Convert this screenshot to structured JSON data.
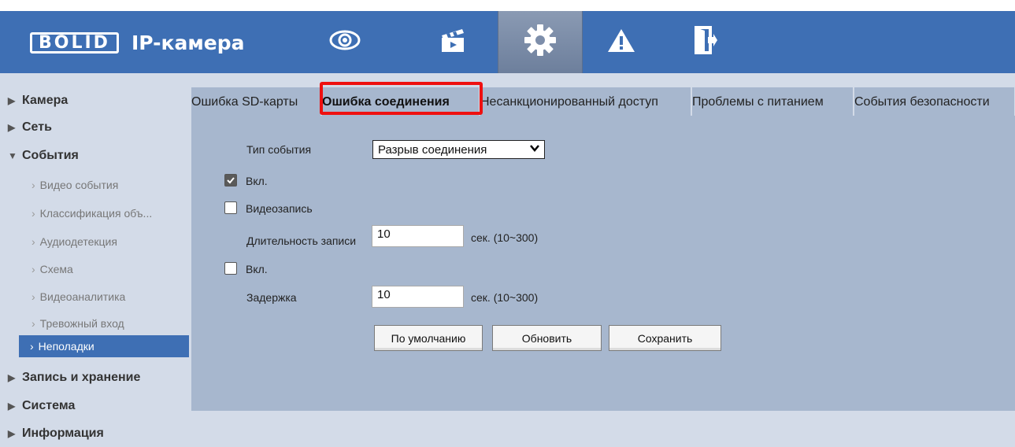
{
  "header": {
    "brand": "BOLID",
    "title": "IP-камера",
    "icons": [
      "eye-icon",
      "clapperboard-icon",
      "gear-icon",
      "warning-icon",
      "logout-icon"
    ],
    "accent": "#3e6fb4"
  },
  "sidebar": {
    "items": [
      {
        "label": "Камера",
        "icon": "triangle-right"
      },
      {
        "label": "Сеть",
        "icon": "triangle-right"
      },
      {
        "label": "События",
        "icon": "triangle-down"
      },
      {
        "label": "Видео события"
      },
      {
        "label": "Классификация объ..."
      },
      {
        "label": "Аудиодетекция"
      },
      {
        "label": "Схема"
      },
      {
        "label": "Видеоаналитика"
      },
      {
        "label": "Тревожный вход"
      },
      {
        "label": "Неполадки"
      },
      {
        "label": "Запись и хранение",
        "icon": "triangle-right"
      },
      {
        "label": "Система",
        "icon": "triangle-right"
      },
      {
        "label": "Информация",
        "icon": "triangle-right"
      }
    ]
  },
  "tabs": [
    {
      "label": "Ошибка SD-карты"
    },
    {
      "label": "Ошибка соединения"
    },
    {
      "label": "Несанкционированный доступ"
    },
    {
      "label": "Проблемы с питанием"
    },
    {
      "label": "События безопасности"
    }
  ],
  "form": {
    "event_type_label": "Тип события",
    "event_type_value": "Разрыв соединения",
    "enable_label": "Вкл.",
    "record_label": "Видеозапись",
    "record_duration_label": "Длительность записи",
    "record_duration_value": "10",
    "record_duration_unit": "сек. (10~300)",
    "enable2_label": "Вкл.",
    "delay_label": "Задержка",
    "delay_value": "10",
    "delay_unit": "сек. (10~300)"
  },
  "buttons": {
    "default": "По умолчанию",
    "refresh": "Обновить",
    "save": "Сохранить"
  },
  "highlight_color": "#ee1010"
}
